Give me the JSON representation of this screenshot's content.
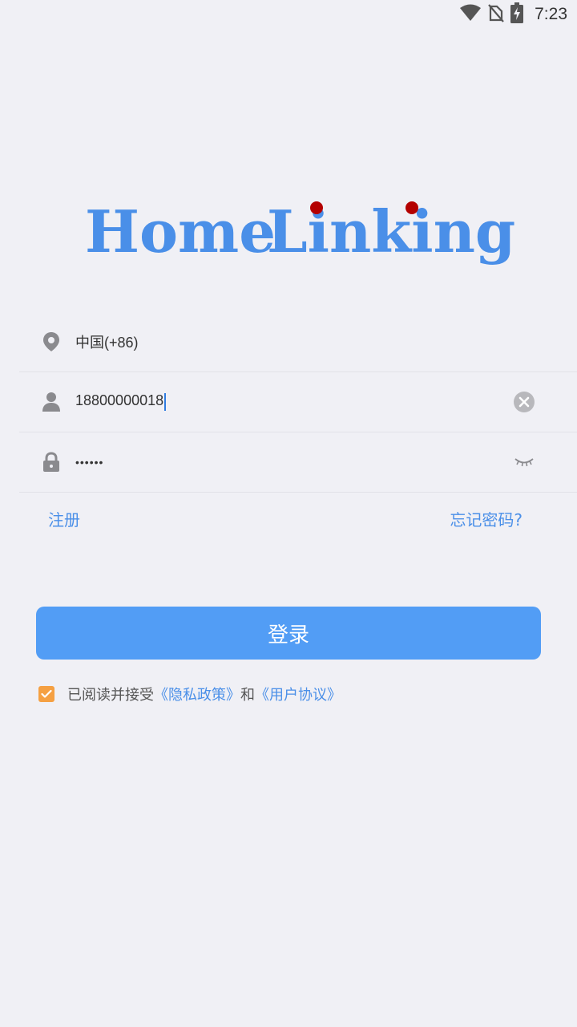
{
  "status_bar": {
    "time": "7:23",
    "icons": [
      "wifi-icon",
      "no-sim-icon",
      "battery-charging-icon"
    ]
  },
  "logo": {
    "word1": "Home",
    "word2": "Linking",
    "text_color": "#4a8fe8",
    "dot_color": "#b40000"
  },
  "form": {
    "country_value": "中国(+86)",
    "phone_value": "18800000018",
    "password_value": "••••••"
  },
  "links": {
    "register": "注册",
    "forgot_password": "忘记密码?"
  },
  "login_button": "登录",
  "agreement": {
    "prefix": "已阅读并接受",
    "privacy_link": "《隐私政策》",
    "conjunction": "和",
    "terms_link": "《用户协议》",
    "checked": true
  },
  "colors": {
    "primary": "#529df5",
    "link": "#4a8fe8",
    "checkbox": "#f5a042",
    "background": "#f0f0f5"
  }
}
